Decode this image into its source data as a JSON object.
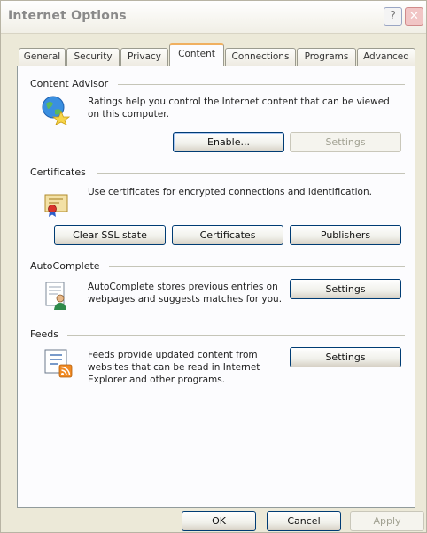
{
  "window": {
    "title": "Internet Options",
    "help_glyph": "?",
    "close_glyph": "✕"
  },
  "tabs": [
    {
      "label": "General"
    },
    {
      "label": "Security"
    },
    {
      "label": "Privacy"
    },
    {
      "label": "Content",
      "active": true
    },
    {
      "label": "Connections"
    },
    {
      "label": "Programs"
    },
    {
      "label": "Advanced"
    }
  ],
  "content_advisor": {
    "heading": "Content Advisor",
    "description": "Ratings help you control the Internet content that can be viewed on this computer.",
    "enable_label": "Enable...",
    "settings_label": "Settings",
    "icon": "globe-star-icon"
  },
  "certificates": {
    "heading": "Certificates",
    "description": "Use certificates for encrypted connections and identification.",
    "clear_ssl_label": "Clear SSL state",
    "certificates_label": "Certificates",
    "publishers_label": "Publishers",
    "icon": "certificate-icon"
  },
  "autocomplete": {
    "heading": "AutoComplete",
    "description": "AutoComplete stores previous entries on webpages and suggests matches for you.",
    "settings_label": "Settings",
    "icon": "autocomplete-icon"
  },
  "feeds": {
    "heading": "Feeds",
    "description": "Feeds provide updated content from websites that can be read in Internet Explorer and other programs.",
    "settings_label": "Settings",
    "icon": "feed-icon"
  },
  "footer": {
    "ok_label": "OK",
    "cancel_label": "Cancel",
    "apply_label": "Apply"
  },
  "colors": {
    "dialog_bg": "#ece9d8",
    "panel_bg": "#fcfcfe",
    "button_border": "#003c74",
    "active_tab_accent": "#f0b060"
  }
}
